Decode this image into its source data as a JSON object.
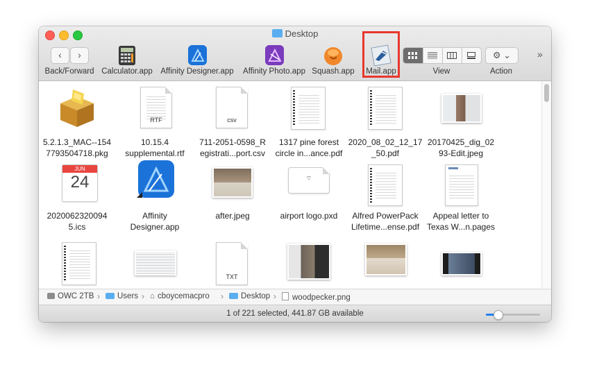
{
  "window": {
    "title": "Desktop"
  },
  "toolbar": {
    "back_forward_label": "Back/Forward",
    "back_glyph": "‹",
    "forward_glyph": "›",
    "apps": [
      {
        "label": "Calculator.app",
        "icon": "calculator-icon"
      },
      {
        "label": "Affinity Designer.app",
        "icon": "affinity-designer-icon"
      },
      {
        "label": "Affinity Photo.app",
        "icon": "affinity-photo-icon"
      },
      {
        "label": "Squash.app",
        "icon": "squash-icon"
      },
      {
        "label": "Mail.app",
        "icon": "mail-icon",
        "highlighted": true
      }
    ],
    "view_label": "View",
    "action_label": "Action",
    "action_glyph": "⚙ ⌄",
    "overflow_glyph": "»",
    "view_modes": [
      "icon",
      "list",
      "column",
      "gallery"
    ],
    "active_view": "icon",
    "highlight_color": "#e8372c"
  },
  "files": [
    {
      "name": "5.2.1.3_MAC--1547793504718.pkg",
      "line1": "5.2.1.3_MAC--154",
      "line2": "7793504718.pkg",
      "icon": "package-icon"
    },
    {
      "name": "10.15.4 supplemental.rtf",
      "line1": "10.15.4",
      "line2": "supplemental.rtf",
      "icon": "rtf-document-icon",
      "ext": "RTF"
    },
    {
      "name": "711-2051-0598_Registrati...port.csv",
      "line1": "711-2051-0598_R",
      "line2": "egistrati...port.csv",
      "icon": "csv-document-icon",
      "ext": "csv"
    },
    {
      "name": "1317 pine forest circle in...ance.pdf",
      "line1": "1317 pine forest",
      "line2": "circle in...ance.pdf",
      "icon": "pdf-document-icon"
    },
    {
      "name": "2020_08_02_12_17_50.pdf",
      "line1": "2020_08_02_12_17",
      "line2": "_50.pdf",
      "icon": "pdf-document-icon"
    },
    {
      "name": "20170425_dig_0293-Edit.jpeg",
      "line1": "20170425_dig_02",
      "line2": "93-Edit.jpeg",
      "icon": "photo-thumbnail-icon"
    },
    {
      "name": "20200623200945.ics",
      "line1": "2020062320094",
      "line2": "5.ics",
      "icon": "calendar-icon",
      "cal_month": "JUN",
      "cal_day": "24"
    },
    {
      "name": "Affinity Designer.app",
      "line1": "Affinity",
      "line2": "Designer.app",
      "icon": "affinity-designer-icon"
    },
    {
      "name": "after.jpeg",
      "line1": "after.jpeg",
      "line2": "",
      "icon": "photo-thumbnail-icon"
    },
    {
      "name": "airport logo.pxd",
      "line1": "airport logo.pxd",
      "line2": "",
      "icon": "pxd-document-icon"
    },
    {
      "name": "Alfred PowerPack Lifetime...ense.pdf",
      "line1": "Alfred PowerPack",
      "line2": "Lifetime...ense.pdf",
      "icon": "pdf-document-icon"
    },
    {
      "name": "Appeal letter to Texas W...n.pages",
      "line1": "Appeal letter to",
      "line2": "Texas W...n.pages",
      "icon": "pages-document-icon"
    },
    {
      "name": "",
      "line1": "",
      "line2": "",
      "icon": "pdf-document-icon"
    },
    {
      "name": "",
      "line1": "",
      "line2": "",
      "icon": "spreadsheet-thumbnail-icon"
    },
    {
      "name": "",
      "line1": "",
      "line2": "",
      "icon": "txt-document-icon",
      "ext": "TXT"
    },
    {
      "name": "",
      "line1": "",
      "line2": "",
      "icon": "photo-thumbnail-icon"
    },
    {
      "name": "",
      "line1": "",
      "line2": "",
      "icon": "photo-thumbnail-icon"
    },
    {
      "name": "",
      "line1": "",
      "line2": "",
      "icon": "photo-thumbnail-icon"
    }
  ],
  "pathbar": [
    {
      "label": "OWC 2TB",
      "icon": "disk-icon"
    },
    {
      "label": "Users",
      "icon": "folder-icon"
    },
    {
      "label": "cboycemacpro",
      "icon": "home-icon"
    },
    {
      "label": "Desktop",
      "icon": "folder-icon"
    },
    {
      "label": "woodpecker.png",
      "icon": "image-file-icon"
    }
  ],
  "pathbar_separator": "›",
  "status": {
    "text": "1 of 221 selected, 441.87 GB available",
    "icon_size_fraction": 0.22
  }
}
